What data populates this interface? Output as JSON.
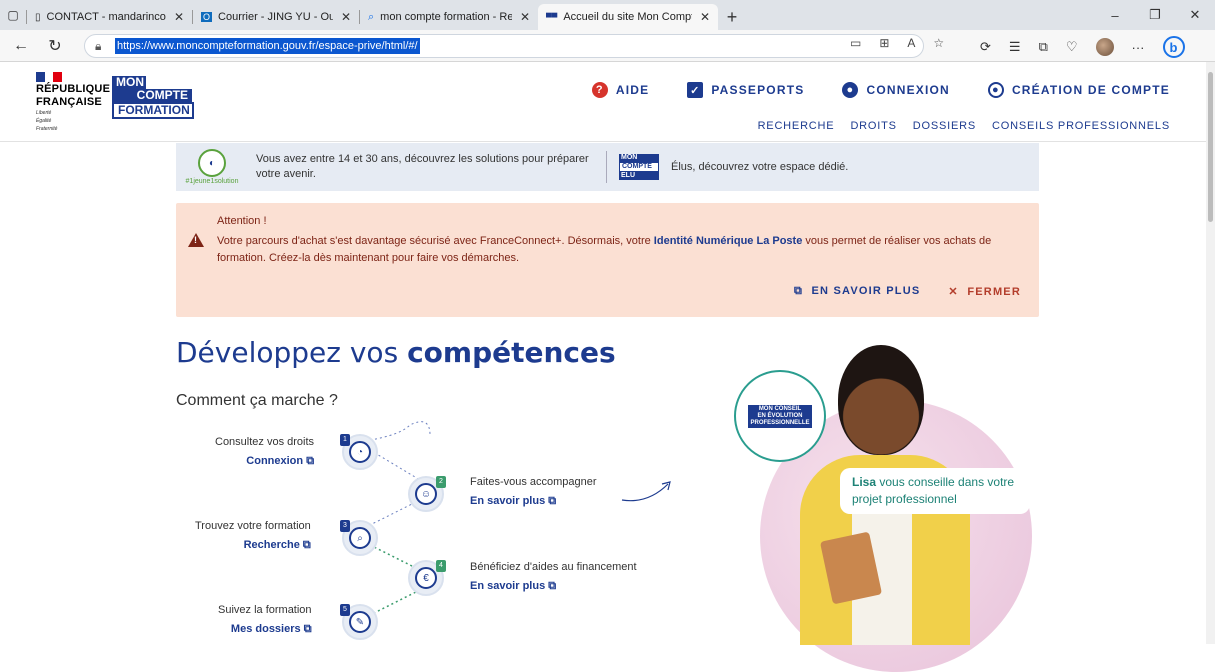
{
  "browser": {
    "tabs": [
      {
        "title": "CONTACT - mandarinconsulting",
        "active": false
      },
      {
        "title": "Courrier - JING YU - Outlook",
        "active": false
      },
      {
        "title": "mon compte formation - Recher",
        "active": false
      },
      {
        "title": "Accueil du site Mon Compte For",
        "active": true
      }
    ],
    "url": "https://www.moncompteformation.gouv.fr/espace-prive/html/#/",
    "colors": {
      "tabbar": "#dfe3e8",
      "url_highlight": "#0b57d0"
    }
  },
  "header": {
    "rf_lines": [
      "RÉPUBLIQUE",
      "FRANÇAISE"
    ],
    "devise": [
      "Liberté",
      "Égalité",
      "Fraternité"
    ],
    "logo_lines": [
      "MON",
      "COMPTE",
      "FORMATION"
    ],
    "nav": [
      {
        "label": "AIDE",
        "icon": "help-icon"
      },
      {
        "label": "PASSEPORTS",
        "icon": "passport-icon"
      },
      {
        "label": "CONNEXION",
        "icon": "user-icon"
      },
      {
        "label": "CRÉATION DE COMPTE",
        "icon": "account-create-icon"
      }
    ],
    "subnav": [
      "RECHERCHE",
      "DROITS",
      "DOSSIERS",
      "CONSEILS PROFESSIONNELS"
    ],
    "colors": {
      "brand": "#1d3b8f",
      "help": "#d6342c"
    }
  },
  "info_banner": {
    "badge_tag": "#1jeune1solution",
    "text_youth": "Vous avez entre 14 et 30 ans, découvrez les solutions pour préparer votre avenir.",
    "elu_logo": [
      "MON",
      "COMPTE",
      "ELU"
    ],
    "text_elus": "Élus, découvrez votre espace dédié."
  },
  "alert": {
    "title": "Attention !",
    "body_before": "Votre parcours d'achat s'est davantage sécurisé avec FranceConnect+. Désormais, votre ",
    "body_link": "Identité Numérique La Poste",
    "body_after": " vous permet de réaliser vos achats de formation. Créez-la dès maintenant pour faire vos démarches.",
    "learn_more": "EN SAVOIR PLUS",
    "close": "FERMER"
  },
  "main": {
    "title_light": "Développez vos ",
    "title_bold": "compétences",
    "howto": "Comment ça marche ?",
    "steps": [
      {
        "text": "Consultez vos droits",
        "link": "Connexion"
      },
      {
        "text": "Faites-vous accompagner",
        "link": "En savoir plus"
      },
      {
        "text": "Trouvez votre formation",
        "link": "Recherche"
      },
      {
        "text": "Bénéficiez d'aides au financement",
        "link": "En savoir plus"
      },
      {
        "text": "Suivez la formation",
        "link": "Mes dossiers"
      }
    ],
    "conseil_badge": [
      "MON CONSEIL",
      "EN ÉVOLUTION",
      "PROFESSIONNELLE"
    ],
    "lisa_bold": "Lisa",
    "lisa_text": " vous conseille dans votre projet professionnel"
  }
}
